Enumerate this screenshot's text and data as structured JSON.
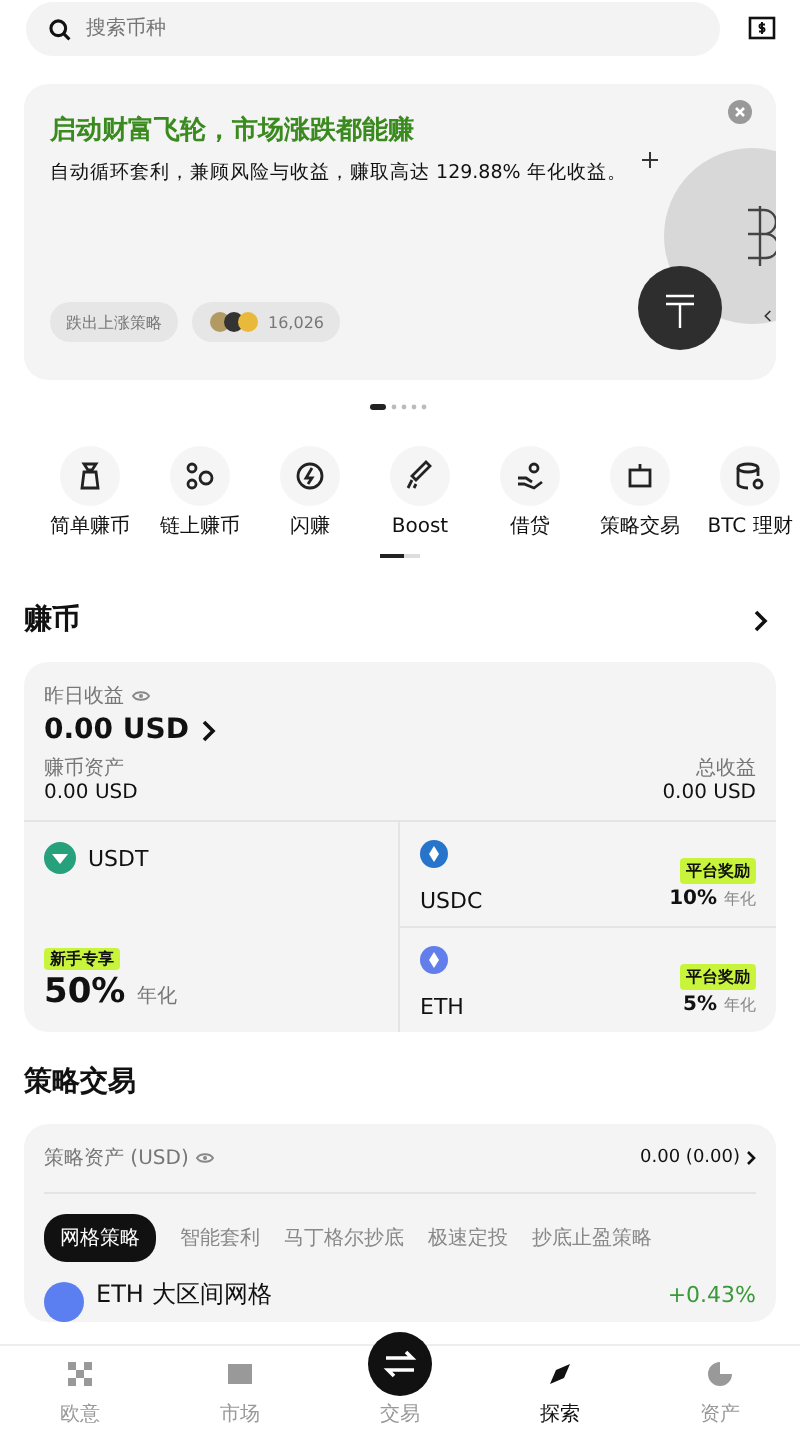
{
  "search": {
    "placeholder": "搜索币种"
  },
  "banner": {
    "title": "启动财富飞轮，市场涨跌都能赚",
    "subtitle": "自动循环套利，兼顾风险与收益，赚取高达 129.88% 年化收益。",
    "tag": "跌出上涨策略",
    "users": "16,026"
  },
  "shortcuts": [
    {
      "label": "简单赚币"
    },
    {
      "label": "链上赚币"
    },
    {
      "label": "闪赚"
    },
    {
      "label": "Boost"
    },
    {
      "label": "借贷"
    },
    {
      "label": "策略交易"
    },
    {
      "label": "BTC 理财"
    }
  ],
  "earn": {
    "title": "赚币",
    "yesterday_label": "昨日收益",
    "yesterday_value": "0.00 USD",
    "assets_label": "赚币资产",
    "assets_value": "0.00 USD",
    "total_label": "总收益",
    "total_value": "0.00 USD",
    "featured": {
      "coin": "USDT",
      "badge": "新手专享",
      "rate": "50%",
      "rate_unit": "年化",
      "color": "#26a17b"
    },
    "coins": [
      {
        "coin": "USDC",
        "badge": "平台奖励",
        "rate": "10%",
        "rate_unit": "年化",
        "color": "#2775ca"
      },
      {
        "coin": "ETH",
        "badge": "平台奖励",
        "rate": "5%",
        "rate_unit": "年化",
        "color": "#627eea"
      }
    ]
  },
  "strategy": {
    "title": "策略交易",
    "assets_label": "策略资产 (USD)",
    "assets_value": "0.00 (0.00)",
    "tabs": [
      {
        "label": "网格策略",
        "selected": true
      },
      {
        "label": "智能套利",
        "selected": false
      },
      {
        "label": "马丁格尔抄底",
        "selected": false
      },
      {
        "label": "极速定投",
        "selected": false
      },
      {
        "label": "抄底止盈策略",
        "selected": false
      }
    ],
    "row": {
      "name": "ETH 大区间网格",
      "change": "+0.43%"
    }
  },
  "nav": [
    {
      "label": "欧意",
      "selected": false
    },
    {
      "label": "市场",
      "selected": false
    },
    {
      "label": "交易",
      "selected": false
    },
    {
      "label": "探索",
      "selected": true
    },
    {
      "label": "资产",
      "selected": false
    }
  ]
}
